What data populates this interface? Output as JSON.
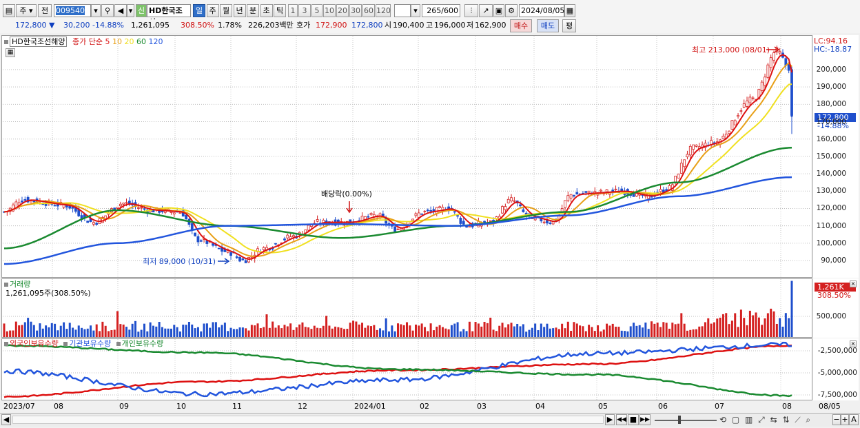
{
  "toolbar": {
    "period_mode": "주",
    "prev_label": "전",
    "stock_code": "009540",
    "new_badge": "신",
    "stock_name": "HD한국조선",
    "period_tabs": [
      "일",
      "주",
      "월",
      "년",
      "분",
      "초",
      "틱"
    ],
    "interval_tabs": [
      "1",
      "3",
      "5",
      "10",
      "20",
      "30",
      "60",
      "120"
    ],
    "count": "265",
    "count_total": "/600",
    "date": "2024/08/05"
  },
  "quote": {
    "price": "172,800",
    "change": "30,200",
    "change_pct": "-14.88%",
    "volume": "1,261,095",
    "volume_ratio": "308.50%",
    "turnover_pct": "1.78%",
    "amount": "226,203백만",
    "ask_label": "호가",
    "ask": "172,900",
    "bid": "172,800",
    "open_label": "시",
    "open": "190,400",
    "high_label": "고",
    "high": "196,000",
    "low_label": "저",
    "low": "162,900",
    "buy_label": "매수",
    "sell_label": "매도",
    "avg_label": "평"
  },
  "price_panel": {
    "stock_tag": "HD한국조선해양",
    "legend_prefix": "종가 단순",
    "ma_periods": [
      "5",
      "10",
      "20",
      "60",
      "120"
    ],
    "ma_colors": [
      "#dd1111",
      "#e8a018",
      "#f0e020",
      "#1a8a30",
      "#2255dd"
    ],
    "lc_label": "LC:94.16",
    "hc_label": "HC:-18.87",
    "price_tag": "172,800",
    "pct_tag": "-14.88%",
    "high_note": "최고 213,000 (08/01)",
    "low_note": "최저 89,000 (10/31)",
    "dividend_note": "배당락(0.00%)",
    "y_ticks": [
      "200,000",
      "190,000",
      "180,000",
      "170,000",
      "160,000",
      "150,000",
      "140,000",
      "130,000",
      "120,000",
      "110,000",
      "100,000",
      "90,000"
    ],
    "y_top_partial": "210,000"
  },
  "volume_panel": {
    "title": "거래량",
    "subtitle": "1,261,095주(308.50%)",
    "tag": "1,261K",
    "tag_pct": "308.50%",
    "y_tick": "500,000"
  },
  "holding_panel": {
    "series": [
      "외국인보유수량",
      "기관보유수량",
      "개인보유수량"
    ],
    "series_colors": [
      "#dd1111",
      "#2255dd",
      "#1a8a30"
    ],
    "y_ticks": [
      "-2,500,000",
      "-5,000,000",
      "-7,500,000"
    ]
  },
  "x_axis": [
    "2023/07",
    "08",
    "09",
    "10",
    "11",
    "12",
    "2024/01",
    "02",
    "03",
    "04",
    "05",
    "06",
    "07",
    "08",
    "08/05"
  ],
  "chart_data": {
    "type": "candlestick",
    "title": "HD한국조선해양",
    "x_range": [
      "2023/07",
      "2024/08/05"
    ],
    "ylim": [
      85000,
      215000
    ],
    "series": [
      {
        "name": "종가",
        "x": [
          "2023/07",
          "2023/08",
          "2023/09",
          "2023/10",
          "2023/10/31",
          "2023/11",
          "2023/12",
          "2024/01",
          "2024/02",
          "2024/03",
          "2024/04",
          "2024/05",
          "2024/06",
          "2024/07",
          "2024/08/01",
          "2024/08/05"
        ],
        "values": [
          120000,
          125000,
          115000,
          105000,
          89000,
          100000,
          112000,
          113000,
          120000,
          113000,
          118000,
          130000,
          128000,
          155000,
          213000,
          172800
        ]
      },
      {
        "name": "60",
        "x": [
          "2023/07",
          "2023/09",
          "2023/11",
          "2024/01",
          "2024/03",
          "2024/05",
          "2024/07",
          "2024/08/05"
        ],
        "values": [
          97000,
          119000,
          110000,
          103000,
          110000,
          118000,
          135000,
          155000
        ]
      },
      {
        "name": "120",
        "x": [
          "2023/07",
          "2023/09",
          "2023/11",
          "2024/01",
          "2024/03",
          "2024/05",
          "2024/07",
          "2024/08/05"
        ],
        "values": [
          88000,
          100000,
          110000,
          111000,
          110000,
          116000,
          127000,
          138000
        ]
      }
    ],
    "volume": {
      "name": "거래량",
      "ylim": [
        0,
        1300000
      ],
      "last": 1261095
    },
    "holdings": {
      "ylim": [
        -8000000,
        -1500000
      ],
      "series": [
        {
          "name": "외국인보유수량",
          "x": [
            "2023/07",
            "2023/11",
            "2024/02",
            "2024/05",
            "2024/08"
          ],
          "values": [
            -7700000,
            -6000000,
            -4700000,
            -4000000,
            -1900000
          ]
        },
        {
          "name": "기관보유수량",
          "x": [
            "2023/07",
            "2023/11",
            "2024/02",
            "2024/05",
            "2024/08"
          ],
          "values": [
            -4800000,
            -7400000,
            -5800000,
            -2800000,
            -1800000
          ]
        },
        {
          "name": "개인보유수량",
          "x": [
            "2023/07",
            "2023/11",
            "2024/02",
            "2024/05",
            "2024/08"
          ],
          "values": [
            -1900000,
            -2700000,
            -4600000,
            -5200000,
            -7600000
          ]
        }
      ]
    }
  }
}
